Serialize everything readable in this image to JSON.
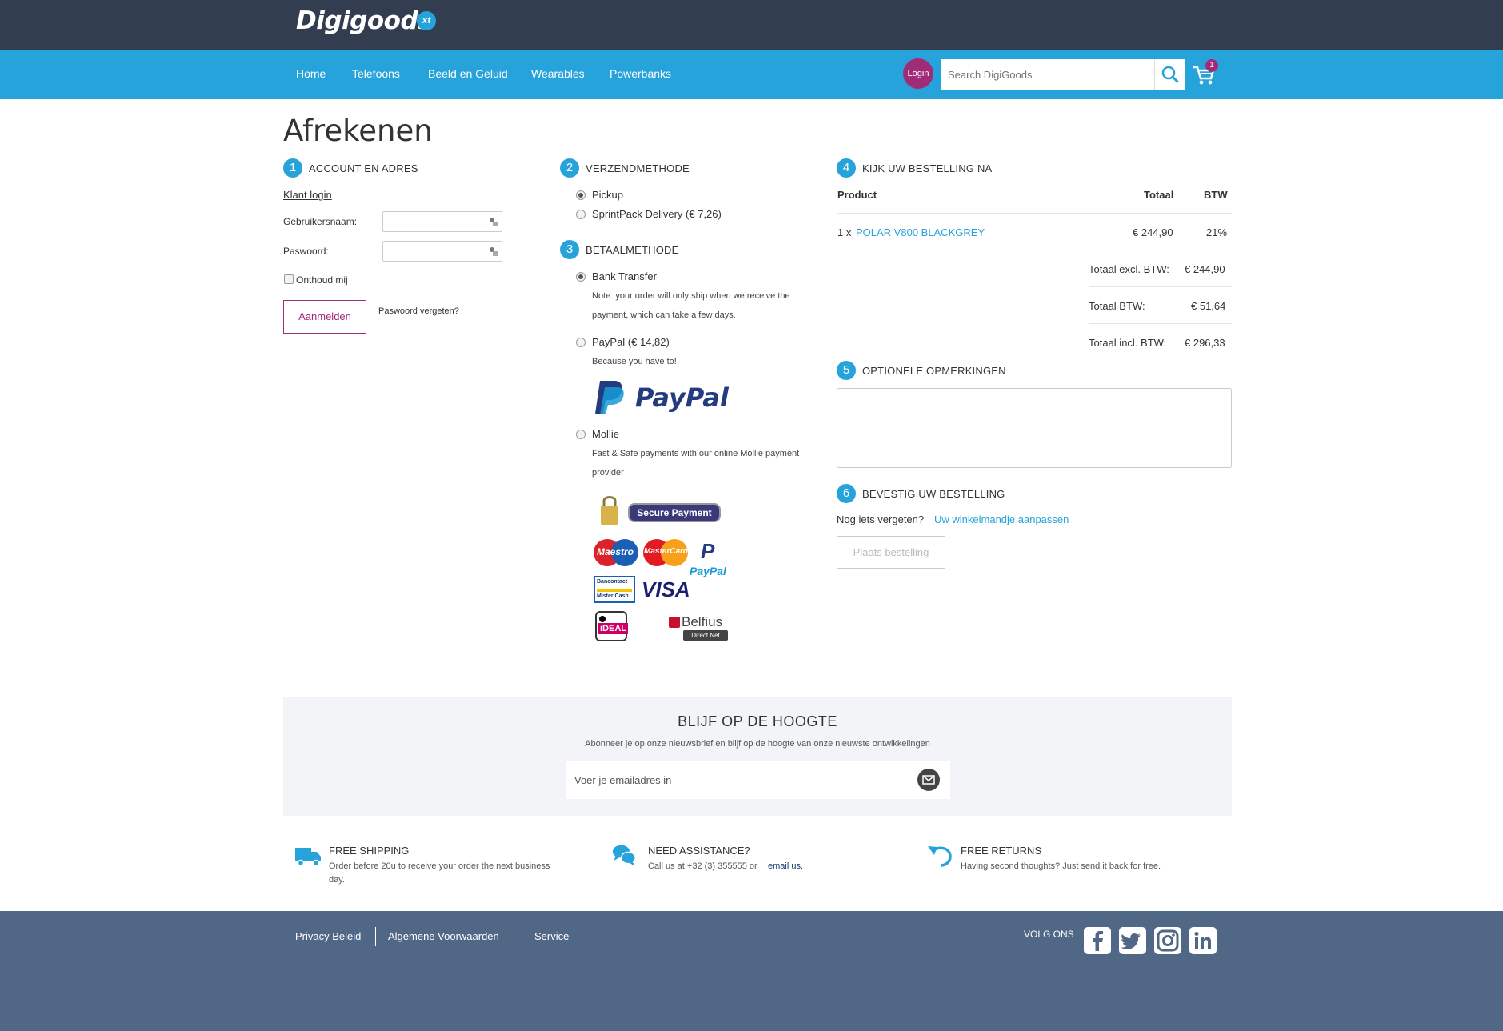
{
  "brand": {
    "name": "Digigoods",
    "badge": "xt"
  },
  "nav": {
    "items": [
      "Home",
      "Telefoons",
      "Beeld en Geluid",
      "Wearables",
      "Powerbanks"
    ],
    "login": "Login",
    "search_placeholder": "Search DigiGoods",
    "cart_count": "1"
  },
  "page_title": "Afrekenen",
  "step1": {
    "num": "1",
    "title": "ACCOUNT EN ADRES",
    "login_link": "Klant login",
    "username_label": "Gebruikersnaam:",
    "password_label": "Paswoord:",
    "remember": "Onthoud mij",
    "submit": "Aanmelden",
    "forgot": "Paswoord vergeten?"
  },
  "step2": {
    "num": "2",
    "title": "VERZENDMETHODE",
    "options": [
      "Pickup",
      "SprintPack Delivery (€ 7,26)"
    ]
  },
  "step3": {
    "num": "3",
    "title": "BETAALMETHODE",
    "bank": {
      "label": "Bank Transfer",
      "note1": "Note: your order will only ship when we receive the",
      "note2": "payment, which can take a few days."
    },
    "paypal": {
      "label": "PayPal (€ 14,82)",
      "note": "Because you have to!"
    },
    "paypal_logo": "PayPal",
    "mollie": {
      "label": "Mollie",
      "note1": "Fast & Safe payments with our online Mollie payment",
      "note2": "provider"
    },
    "secure_payment": "Secure Payment",
    "card_logos": {
      "maestro": "Maestro",
      "mastercard": "MasterCard",
      "paypal": "PayPal",
      "bancontact1": "Bancontact",
      "bancontact2": "Mister Cash",
      "visa": "VISA",
      "ideal": "iDEAL",
      "belfius": "Belfius",
      "belfius_sub": "Direct Net"
    }
  },
  "step4": {
    "num": "4",
    "title": "KIJK UW BESTELLING NA",
    "headers": {
      "product": "Product",
      "total": "Totaal",
      "vat": "BTW"
    },
    "line": {
      "qty": "1 x",
      "name": "POLAR V800 BLACKGREY",
      "total": "€ 244,90",
      "vat": "21%"
    },
    "totals": [
      {
        "label": "Totaal excl. BTW:",
        "value": "€ 244,90"
      },
      {
        "label": "Totaal BTW:",
        "value": "€ 51,64"
      },
      {
        "label": "Totaal incl. BTW:",
        "value": "€ 296,33"
      }
    ]
  },
  "step5": {
    "num": "5",
    "title": "OPTIONELE OPMERKINGEN"
  },
  "step6": {
    "num": "6",
    "title": "BEVESTIG UW BESTELLING",
    "forgot_text": "Nog iets vergeten?",
    "edit_cart": "Uw winkelmandje aanpassen",
    "place_order": "Plaats bestelling"
  },
  "newsletter": {
    "title": "BLIJF OP DE HOOGTE",
    "subtitle": "Abonneer je op onze nieuwsbrief en blijf op de hoogte van onze nieuwste ontwikkelingen",
    "placeholder": "Voer je emailadres in"
  },
  "usps": [
    {
      "title": "FREE SHIPPING",
      "line1": "Order before 20u to receive your order the next business",
      "line2": "day."
    },
    {
      "title": "NEED ASSISTANCE?",
      "text": "Call us at +32 (3) 355555 or",
      "link": "email us."
    },
    {
      "title": "FREE RETURNS",
      "line1": "Having second thoughts? Just send it back for free."
    }
  ],
  "footer": {
    "links": [
      "Privacy Beleid",
      "Algemene Voorwaarden",
      "Service"
    ],
    "follow": "VOLG ONS"
  },
  "colors": {
    "accent": "#27a3db",
    "brand_purple": "#a02c78",
    "topbar": "#323d4f",
    "footer": "#516786"
  }
}
